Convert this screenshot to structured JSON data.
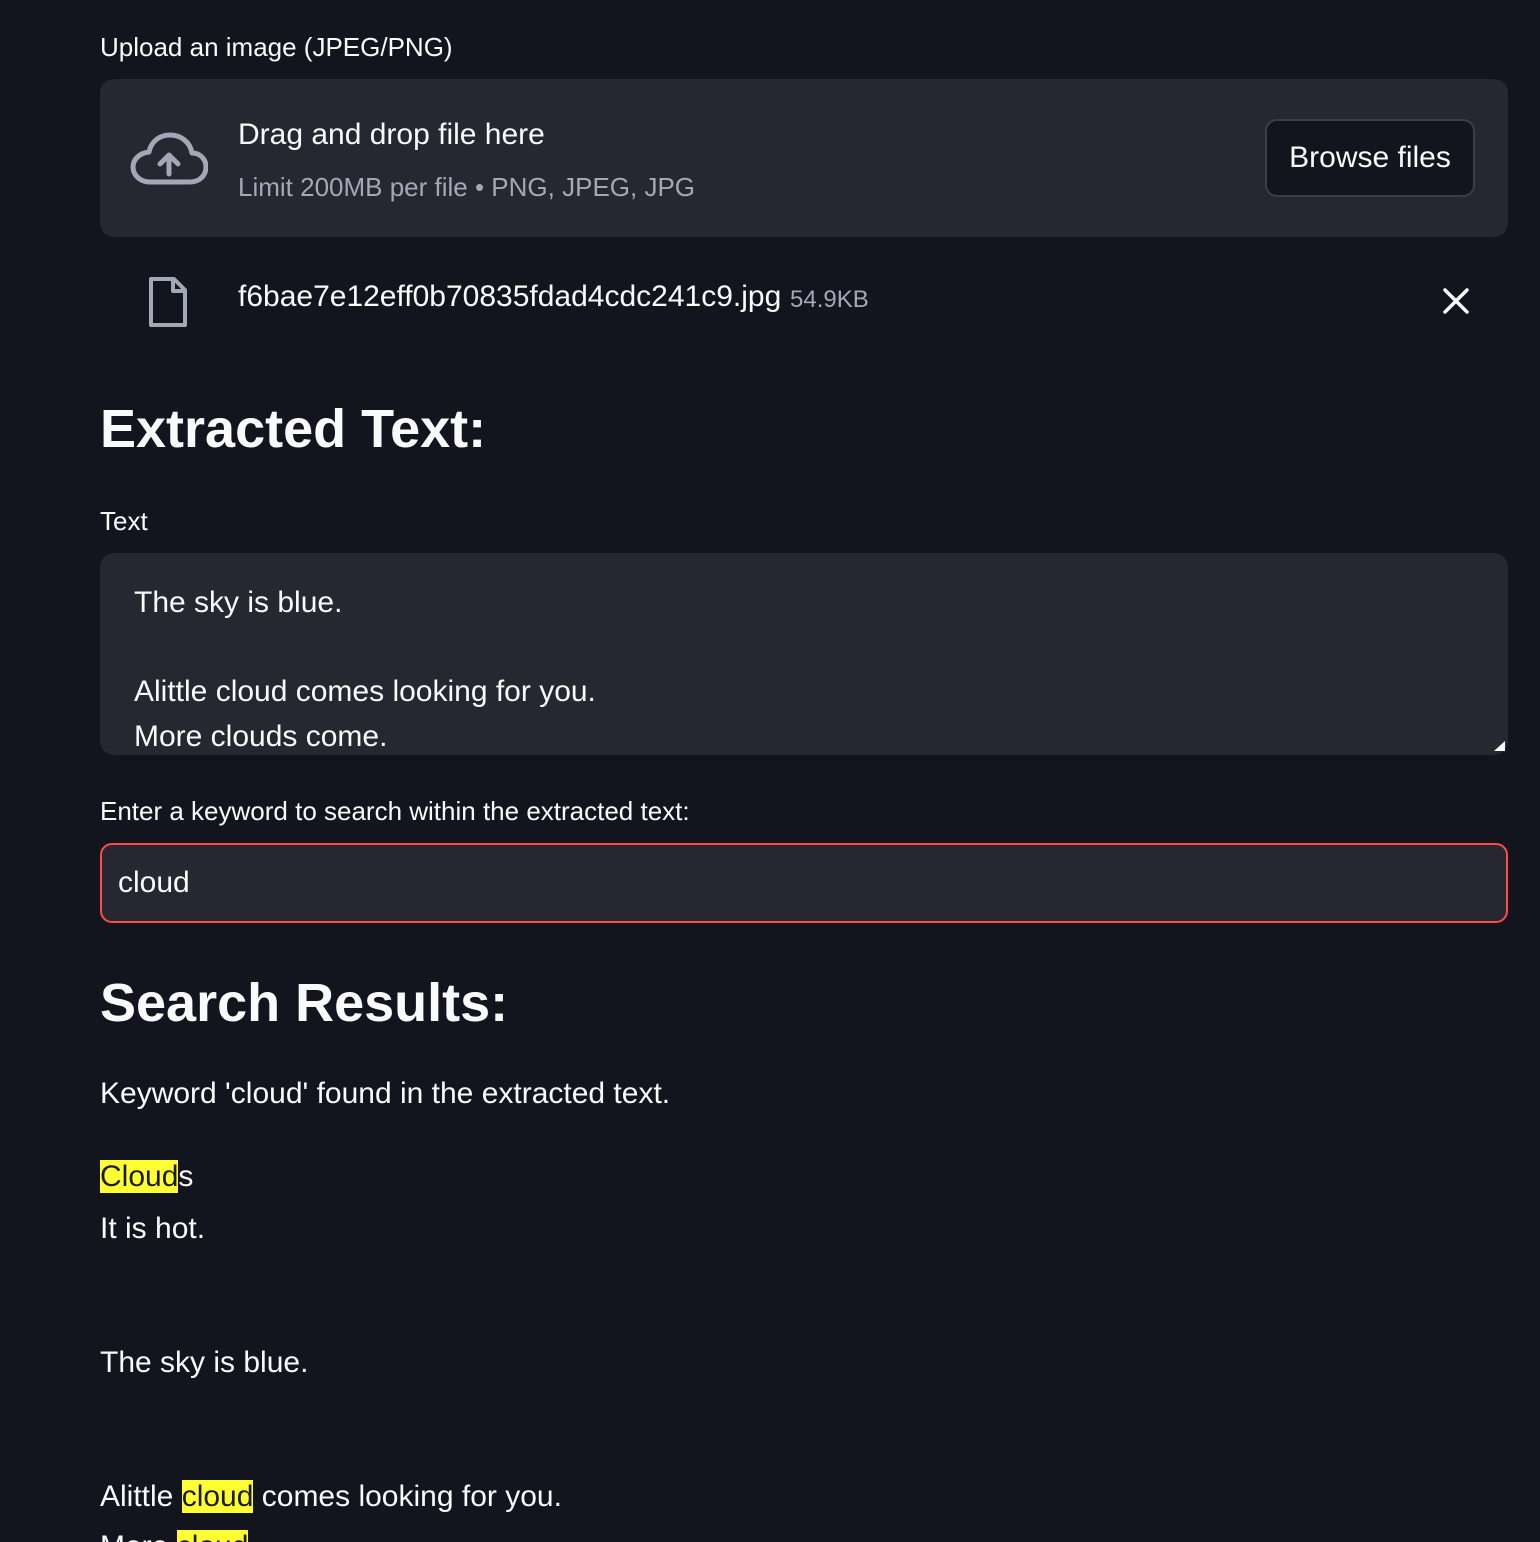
{
  "uploader": {
    "label": "Upload an image (JPEG/PNG)",
    "dropzone_title": "Drag and drop file here",
    "dropzone_limit": "Limit 200MB per file • PNG, JPEG, JPG",
    "browse_label": "Browse files",
    "icon": "cloud-upload-icon"
  },
  "uploaded_file": {
    "name": "f6bae7e12eff0b70835fdad4cdc241c9.jpg",
    "size": "54.9KB",
    "icon": "file-icon",
    "remove_icon": "close-icon"
  },
  "extracted": {
    "heading": "Extracted Text:",
    "textarea_label": "Text",
    "textarea_value": "The sky is blue.\n\nAlittle cloud comes looking for you.\nMore clouds come."
  },
  "search": {
    "label": "Enter a keyword to search within the extracted text:",
    "value": "cloud"
  },
  "results": {
    "heading": "Search Results:",
    "found_message": "Keyword 'cloud' found in the extracted text.",
    "line1_highlight": "Cloud",
    "line1_rest": "s",
    "line2": "It is hot.",
    "line3": "The sky is blue.",
    "line4_pre": "Alittle ",
    "line4_highlight": "cloud",
    "line4_post": " comes looking for you.",
    "line5_pre": "More ",
    "line5_highlight": "cloud"
  },
  "colors": {
    "background": "#12151e",
    "widget_bg": "#262730",
    "focus_border": "#ff4b4b",
    "highlight": "#ffff33"
  }
}
